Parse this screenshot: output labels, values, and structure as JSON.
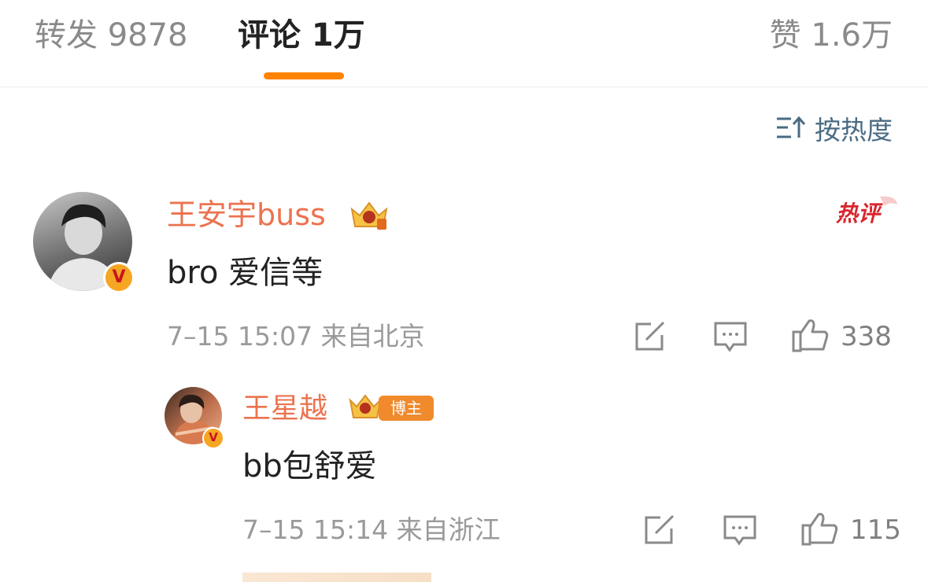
{
  "tabs": {
    "repost": "转发 9878",
    "comments": "评论 1万",
    "likes": "赞 1.6万"
  },
  "sort": {
    "label": "按热度",
    "icon": "sort-icon"
  },
  "comment": {
    "user": "王安宇buss",
    "text": "bro 爱信等",
    "meta": "7–15 15:07 来自北京",
    "like_count": "338",
    "hot_label": "热评",
    "verified": "V"
  },
  "reply": {
    "user": "王星越",
    "badge": "博主",
    "text": "bb包舒爱",
    "meta": "7–15 15:14 来自浙江",
    "like_count": "115",
    "verified": "V"
  },
  "colors": {
    "accent": "#ff8200",
    "username": "#eb7350",
    "muted": "#9a9a9a",
    "link": "#4a6b83"
  }
}
